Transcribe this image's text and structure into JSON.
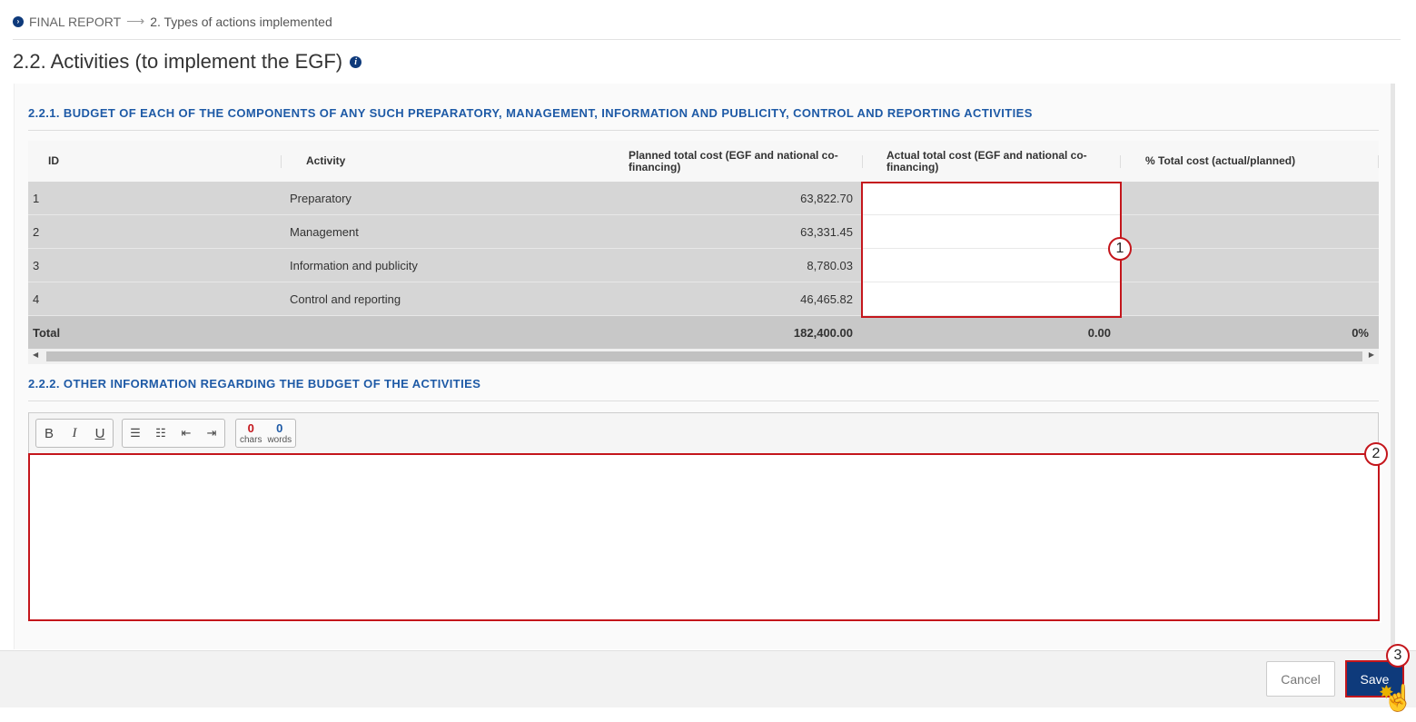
{
  "breadcrumb": {
    "root": "FINAL REPORT",
    "arrow": "⟶",
    "current": "2. Types of actions implemented"
  },
  "page": {
    "title": "2.2. Activities (to implement the EGF)",
    "info_icon": "i"
  },
  "section1": {
    "title": "2.2.1. BUDGET OF EACH OF THE COMPONENTS OF ANY SUCH PREPARATORY, MANAGEMENT, INFORMATION AND PUBLICITY, CONTROL AND REPORTING ACTIVITIES",
    "columns": {
      "id": "ID",
      "activity": "Activity",
      "planned": "Planned total cost (EGF and national co-financing)",
      "actual": "Actual total cost (EGF and national co-financing)",
      "pct": "% Total cost (actual/planned)"
    },
    "rows": [
      {
        "id": "1",
        "activity": "Preparatory",
        "planned": "63,822.70",
        "actual": "",
        "pct": ""
      },
      {
        "id": "2",
        "activity": "Management",
        "planned": "63,331.45",
        "actual": "",
        "pct": ""
      },
      {
        "id": "3",
        "activity": "Information and publicity",
        "planned": "8,780.03",
        "actual": "",
        "pct": ""
      },
      {
        "id": "4",
        "activity": "Control and reporting",
        "planned": "46,465.82",
        "actual": "",
        "pct": ""
      }
    ],
    "total": {
      "label": "Total",
      "planned": "182,400.00",
      "actual": "0.00",
      "pct": "0%"
    }
  },
  "section2": {
    "title": "2.2.2. OTHER INFORMATION REGARDING THE BUDGET OF THE ACTIVITIES",
    "editor": {
      "chars_count": "0",
      "chars_label": "chars",
      "words_count": "0",
      "words_label": "words",
      "value": ""
    }
  },
  "callouts": [
    "1",
    "2",
    "3"
  ],
  "footer": {
    "cancel_label": "Cancel",
    "save_label": "Save"
  },
  "colors": {
    "accent": "#0e3a7b",
    "section_heading": "#1e5aa6",
    "highlight": "#c4161c"
  },
  "icons": [
    "chevron-right-icon",
    "info-icon",
    "bold-icon",
    "italic-icon",
    "underline-icon",
    "ordered-list-icon",
    "unordered-list-icon",
    "outdent-icon",
    "indent-icon",
    "hand-cursor-icon"
  ]
}
